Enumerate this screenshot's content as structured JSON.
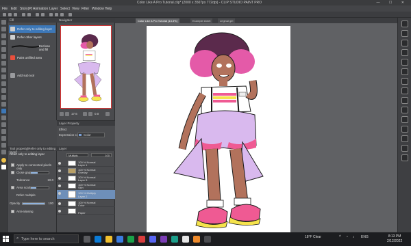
{
  "window": {
    "title": "Color Like A Pro Tutorial.clip* (2000 x 3507px 772dpi) - CLIP STUDIO PAINT PRO",
    "controls": [
      "—",
      "☐",
      "✕"
    ]
  },
  "menu": [
    "File",
    "Edit",
    "Story(P)",
    "Animation",
    "Layer",
    "Select",
    "View",
    "Filter",
    "Window",
    "Help"
  ],
  "subtool": {
    "header": "Fill",
    "items": [
      {
        "label": "Refer only to editing layer",
        "selected": true
      },
      {
        "label": "Refer other layers",
        "selected": false
      },
      {
        "label": "Enclose and fill",
        "selected": false
      },
      {
        "label": "Paint unfilled area",
        "selected": false
      },
      {
        "label": "Add sub tool",
        "selected": false
      }
    ]
  },
  "navigator": {
    "header": "Navigator",
    "zoom": "17.6",
    "rotation": "0.0"
  },
  "tool_property": {
    "header": "Tool property[Refer only to editing layer]",
    "title": "Refer only to editing layer",
    "rows": [
      {
        "label": "Apply to connected pixels only",
        "checked": true,
        "value": ""
      },
      {
        "label": "Close gap",
        "checked": true,
        "value": ""
      },
      {
        "label": "Tolerance",
        "checked": false,
        "value": "10.0"
      },
      {
        "label": "Area scaling",
        "checked": true,
        "value": ""
      },
      {
        "label": "Refer multiple",
        "checked": false,
        "value": ""
      },
      {
        "label": "Opacity",
        "checked": false,
        "value": "100"
      },
      {
        "label": "Anti-aliasing",
        "checked": true,
        "value": ""
      }
    ]
  },
  "layer_property": {
    "header": "Layer Property",
    "section": "Effect",
    "expression_label": "Expression color",
    "expression_value": "Color"
  },
  "layers": {
    "header": "Layer",
    "blend_mode": "Multiply",
    "opacity": "100",
    "items": [
      {
        "line1": "100 % Normal",
        "line2": "Layer 1",
        "selected": false,
        "folder": false
      },
      {
        "line1": "100 % Normal",
        "line2": "Overlay",
        "selected": false,
        "folder": true
      },
      {
        "line1": "100 % Normal",
        "line2": "Layer 3",
        "selected": false,
        "folder": false
      },
      {
        "line1": "100 % Normal",
        "line2": "Skin",
        "selected": false,
        "folder": false
      },
      {
        "line1": "100 % Multiply",
        "line2": "Layer 2",
        "selected": true,
        "folder": false
      },
      {
        "line1": "100 % Normal",
        "line2": "Color",
        "selected": false,
        "folder": false
      },
      {
        "line1": "",
        "line2": "Paper",
        "selected": false,
        "folder": false
      }
    ]
  },
  "tabs": [
    {
      "label": "Color Like A Pro Tutorial (13.3%)",
      "active": true
    },
    {
      "label": "Example sheet",
      "active": false
    },
    {
      "label": "original girl",
      "active": false
    }
  ],
  "taskbar": {
    "search_placeholder": "Type here to search",
    "weather": "18°F Clear",
    "lang": "ENG",
    "time": "8:13 PM",
    "date": "2/12/2022"
  },
  "colors": {
    "accent": "#3d78b8",
    "skin": "#b2725c",
    "hair": "#5b2a4c",
    "lilac": "#d9b9ee",
    "pink": "#ef5a93",
    "yellow": "#f5e34c"
  }
}
